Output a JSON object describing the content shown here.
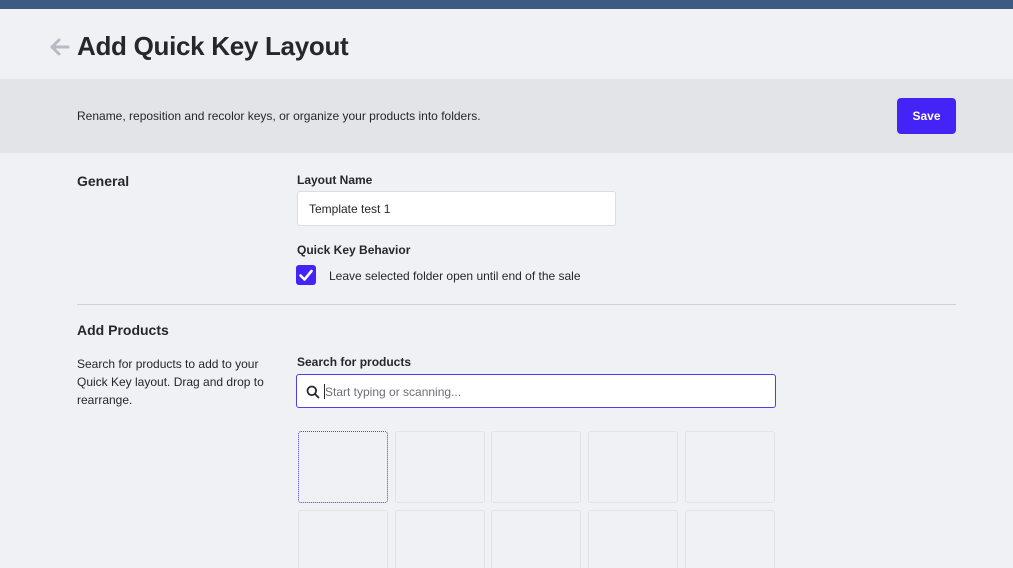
{
  "page": {
    "title": "Add Quick Key Layout",
    "back_icon": "arrow-left-icon"
  },
  "banner": {
    "text": "Rename, reposition and recolor keys, or organize your products into folders.",
    "save_label": "Save"
  },
  "general": {
    "section_title": "General",
    "layout_name_label": "Layout Name",
    "layout_name_value": "Template test 1",
    "behavior_label": "Quick Key Behavior",
    "checkbox_label": "Leave selected folder open until end of the sale",
    "checkbox_checked": true
  },
  "add_products": {
    "section_title": "Add Products",
    "description": "Search for products to add to your Quick Key layout. Drag and drop to rearrange.",
    "search_label": "Search for products",
    "search_placeholder": "Start typing or scanning...",
    "search_value": ""
  },
  "colors": {
    "accent": "#4323f5",
    "top_bar": "#3d5a80",
    "banner_bg": "#e3e4e8",
    "page_bg": "#f0f1f5"
  }
}
